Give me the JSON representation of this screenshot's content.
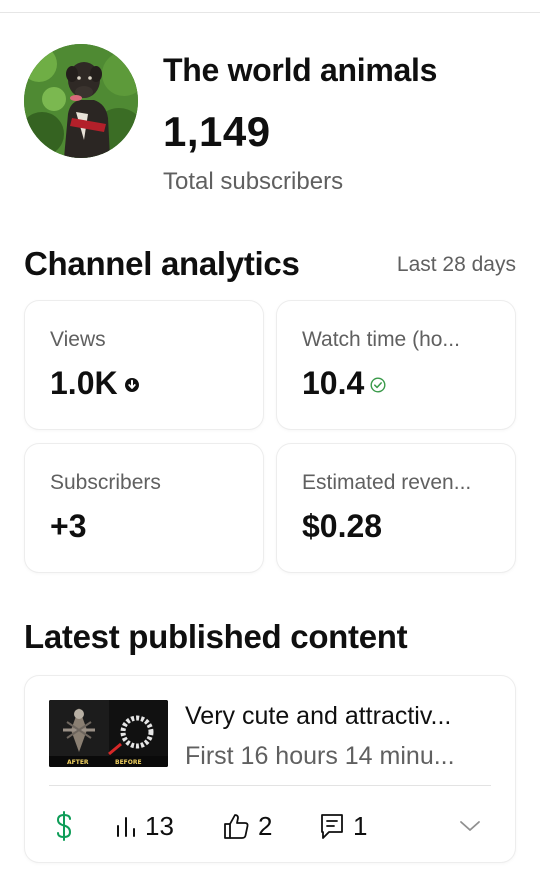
{
  "channel": {
    "name": "The world animals",
    "subscriber_count": "1,149",
    "subscriber_label": "Total subscribers",
    "avatar_icon": "dog-avatar-icon"
  },
  "analytics": {
    "title": "Channel analytics",
    "period": "Last 28 days",
    "cards": [
      {
        "label": "Views",
        "value": "1.0K",
        "indicator": "arrow-down-circle-icon"
      },
      {
        "label": "Watch time (ho...",
        "value": "10.4",
        "indicator": "check-circle-icon"
      },
      {
        "label": "Subscribers",
        "value": "+3"
      },
      {
        "label": "Estimated reven...",
        "value": "$0.28"
      }
    ]
  },
  "latest": {
    "title": "Latest published content",
    "video": {
      "title": "Very cute and attractiv...",
      "age": "First 16 hours 14 minu...",
      "thumbnail_text": [
        "AFTER",
        "BEFORE"
      ],
      "stats": {
        "views": "13",
        "likes": "2",
        "comments": "1"
      }
    }
  },
  "colors": {
    "accent_green": "#0f9d58",
    "text_primary": "#0f0f0f",
    "text_secondary": "#606060"
  }
}
